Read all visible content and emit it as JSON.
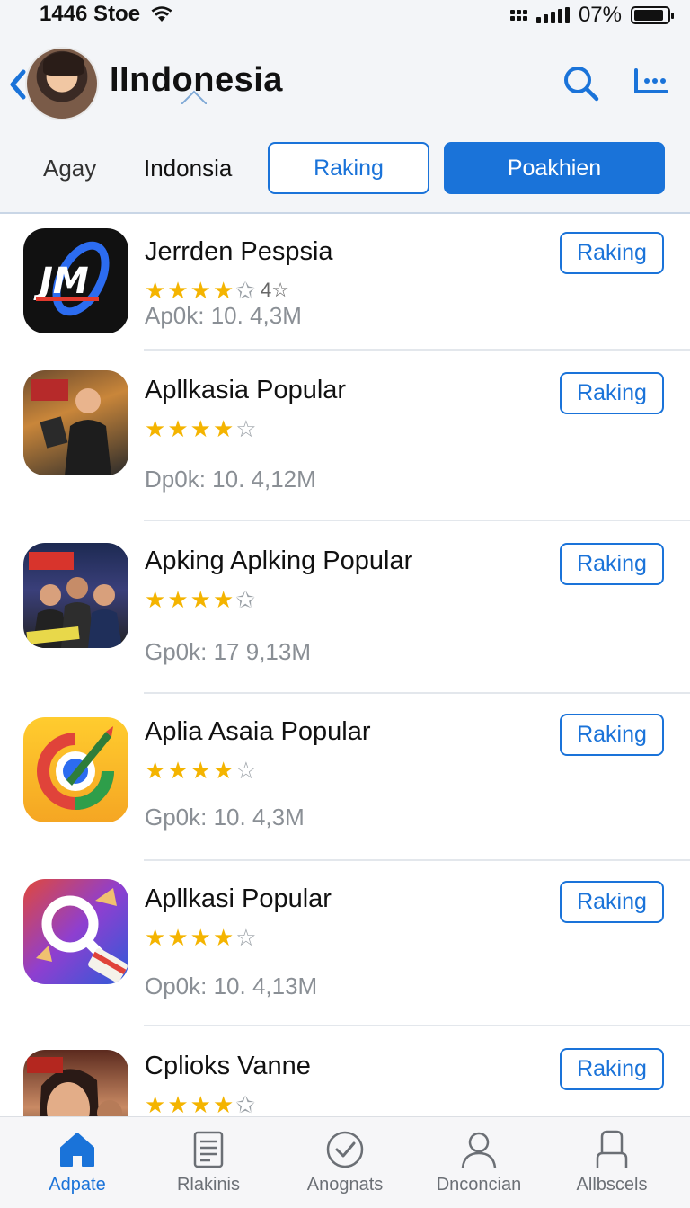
{
  "status": {
    "time_carrier": "1446 Stoe",
    "battery_text": "07%",
    "battery_level": 0.9
  },
  "header": {
    "title": "IIndonesia",
    "tabs": [
      {
        "label": "Agay"
      },
      {
        "label": "Indonsia"
      },
      {
        "label": "Raking"
      },
      {
        "label": "Poakhien"
      }
    ]
  },
  "apps": [
    {
      "name": "Jerrden Pespsia",
      "rating_extra": "4☆",
      "meta": "Ap0k: 10. 4,3M",
      "button": "Raking",
      "icon": "jm-logo-icon"
    },
    {
      "name": "Apllkasia Popular",
      "rating_extra": "",
      "meta": "Dp0k: 10. 4,12M",
      "button": "Raking",
      "icon": "movie-poster-icon"
    },
    {
      "name": "Apking Aplking Popular",
      "rating_extra": "",
      "meta": "Gp0k: 17  9,13M",
      "button": "Raking",
      "icon": "group-poster-icon"
    },
    {
      "name": "Aplia Asaia Popular",
      "rating_extra": "",
      "meta": "Gp0k: 10. 4,3M",
      "button": "Raking",
      "icon": "compass-icon"
    },
    {
      "name": "Apllkasi Popular",
      "rating_extra": "",
      "meta": "Op0k: 10. 4,13M",
      "button": "Raking",
      "icon": "magnifier-icon"
    },
    {
      "name": "Cplioks Vanne",
      "rating_extra": "",
      "meta": "",
      "button": "Raking",
      "icon": "portrait-icon"
    }
  ],
  "ratings": [
    4.5,
    4,
    4.5,
    4,
    4,
    4.5
  ],
  "bottom_nav": [
    {
      "label": "Adpate",
      "icon": "home-icon",
      "active": true
    },
    {
      "label": "Rlakinis",
      "icon": "document-icon",
      "active": false
    },
    {
      "label": "Anognats",
      "icon": "check-circle-icon",
      "active": false
    },
    {
      "label": "Dnconcian",
      "icon": "person-icon",
      "active": false
    },
    {
      "label": "Allbscels",
      "icon": "profile-icon",
      "active": false
    }
  ],
  "colors": {
    "accent": "#1a73d9",
    "star": "#f4b400"
  }
}
